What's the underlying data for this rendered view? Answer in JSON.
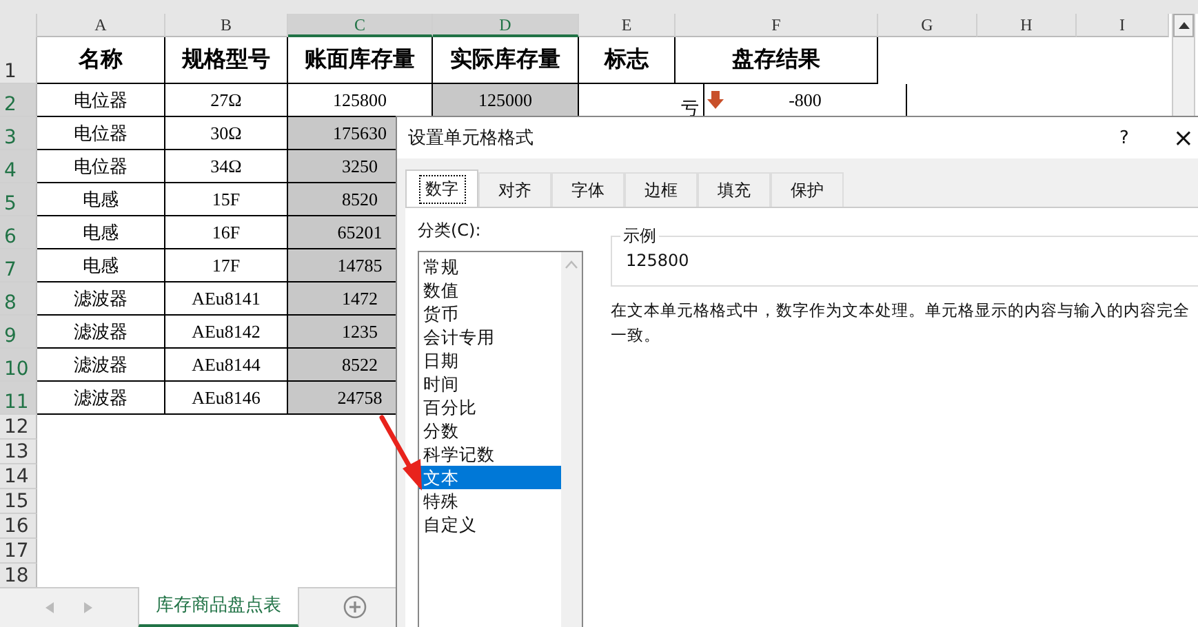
{
  "columns": [
    {
      "label": "A",
      "selected": false
    },
    {
      "label": "B",
      "selected": false
    },
    {
      "label": "C",
      "selected": true
    },
    {
      "label": "D",
      "selected": true
    },
    {
      "label": "E",
      "selected": false
    },
    {
      "label": "F",
      "selected": false
    },
    {
      "label": "G",
      "selected": false
    },
    {
      "label": "H",
      "selected": false
    },
    {
      "label": "I",
      "selected": false
    }
  ],
  "header_row": {
    "row": "1",
    "selected": false,
    "cells": [
      "名称",
      "规格型号",
      "账面库存量",
      "实际库存量",
      "标志",
      "盘存结果"
    ]
  },
  "rows": [
    {
      "row": "2",
      "selected": true,
      "cells": [
        {
          "text": "电位器"
        },
        {
          "text": "27Ω"
        },
        {
          "text": "125800",
          "shaded": false
        },
        {
          "text": "125000",
          "shaded": true
        },
        {
          "text": "亏"
        },
        {
          "text": "-800",
          "decrease": true
        }
      ]
    },
    {
      "row": "3",
      "selected": true,
      "cells": [
        {
          "text": "电位器"
        },
        {
          "text": "30Ω"
        },
        {
          "text": "175630",
          "shaded": true
        }
      ]
    },
    {
      "row": "4",
      "selected": true,
      "cells": [
        {
          "text": "电位器"
        },
        {
          "text": "34Ω"
        },
        {
          "text": "3250",
          "shaded": true
        }
      ]
    },
    {
      "row": "5",
      "selected": true,
      "cells": [
        {
          "text": "电感"
        },
        {
          "text": "15F"
        },
        {
          "text": "8520",
          "shaded": true
        }
      ]
    },
    {
      "row": "6",
      "selected": true,
      "cells": [
        {
          "text": "电感"
        },
        {
          "text": "16F"
        },
        {
          "text": "65201",
          "shaded": true
        }
      ]
    },
    {
      "row": "7",
      "selected": true,
      "cells": [
        {
          "text": "电感"
        },
        {
          "text": "17F"
        },
        {
          "text": "14785",
          "shaded": true
        }
      ]
    },
    {
      "row": "8",
      "selected": true,
      "cells": [
        {
          "text": "滤波器"
        },
        {
          "text": "AEu8141"
        },
        {
          "text": "1472",
          "shaded": true
        }
      ]
    },
    {
      "row": "9",
      "selected": true,
      "cells": [
        {
          "text": "滤波器"
        },
        {
          "text": "AEu8142"
        },
        {
          "text": "1235",
          "shaded": true
        }
      ]
    },
    {
      "row": "10",
      "selected": true,
      "cells": [
        {
          "text": "滤波器"
        },
        {
          "text": "AEu8144"
        },
        {
          "text": "8522",
          "shaded": true
        }
      ]
    },
    {
      "row": "11",
      "selected": true,
      "cells": [
        {
          "text": "滤波器"
        },
        {
          "text": "AEu8146"
        },
        {
          "text": "24758",
          "shaded": true
        }
      ]
    }
  ],
  "empty_rows": [
    "12",
    "13",
    "14",
    "15",
    "16",
    "17",
    "18"
  ],
  "sheet_tabs": [
    {
      "label": "库存商品盘点表",
      "selected": true
    }
  ],
  "dialog": {
    "title": "设置单元格格式",
    "help": "?",
    "close": "×",
    "tabs": [
      {
        "label": "数字",
        "selected": true
      },
      {
        "label": "对齐",
        "selected": false
      },
      {
        "label": "字体",
        "selected": false
      },
      {
        "label": "边框",
        "selected": false
      },
      {
        "label": "填充",
        "selected": false
      },
      {
        "label": "保护",
        "selected": false
      }
    ],
    "category_label": "分类(C):",
    "categories": [
      {
        "label": "常规",
        "selected": false
      },
      {
        "label": "数值",
        "selected": false
      },
      {
        "label": "货币",
        "selected": false
      },
      {
        "label": "会计专用",
        "selected": false
      },
      {
        "label": "日期",
        "selected": false
      },
      {
        "label": "时间",
        "selected": false
      },
      {
        "label": "百分比",
        "selected": false
      },
      {
        "label": "分数",
        "selected": false
      },
      {
        "label": "科学记数",
        "selected": false
      },
      {
        "label": "文本",
        "selected": true
      },
      {
        "label": "特殊",
        "selected": false
      },
      {
        "label": "自定义",
        "selected": false
      }
    ],
    "sample_label": "示例",
    "sample_value": "125800",
    "description": "在文本单元格格式中，数字作为文本处理。单元格显示的内容与输入的内容完全一致。"
  }
}
